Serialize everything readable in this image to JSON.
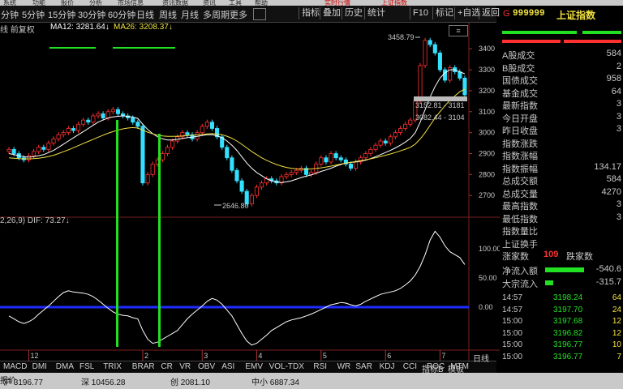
{
  "top_menu": [
    "系统",
    "功能",
    "报价",
    "分析",
    "市场信息",
    "资讯数据",
    "资讯",
    "工具",
    "帮助",
    "通达信",
    "实时行情",
    "上证指数"
  ],
  "toolbar": {
    "periods": [
      "分钟",
      "5分钟",
      "15分钟",
      "30分钟",
      "60分钟",
      "日线",
      "周线",
      "月线",
      "多周期",
      "更多"
    ],
    "search": "",
    "buttons": [
      "指标",
      "叠加",
      "历史",
      "统计",
      "F10",
      "标记",
      "+自选",
      "返回"
    ]
  },
  "legend": {
    "mode": "线 前复权",
    "ma12": "MA12: 3281.64↓",
    "ma26": "MA26: 3208.37↓",
    "high_label": "3458.79",
    "low_label": "2646.80",
    "range1": "3152.81 - 3181",
    "range2": "3082.44 - 3104",
    "macd": "2,26,9)  DIF: 73.27↓"
  },
  "chart_data": {
    "type": "candlestick",
    "price_ticks": [
      "3400",
      "3300",
      "3200",
      "3100",
      "3000",
      "2900",
      "2800",
      "2700"
    ],
    "macd_ticks": [
      "100.00",
      "50.00",
      "0.00"
    ],
    "x_ticks": [
      "12",
      "2",
      "3",
      "4",
      "5",
      "6",
      "7"
    ],
    "close": [
      2920,
      2900,
      2880,
      2870,
      2890,
      2910,
      2930,
      2920,
      2950,
      2970,
      2990,
      3000,
      3020,
      3010,
      3040,
      3060,
      3050,
      3080,
      3090,
      3070,
      3100,
      3110,
      3090,
      3080,
      3070,
      3050,
      3030,
      2760,
      2800,
      2850,
      2870,
      2900,
      2930,
      2960,
      2980,
      3000,
      2990,
      2970,
      3000,
      3030,
      3050,
      3020,
      2980,
      2930,
      2880,
      2820,
      2770,
      2720,
      2660,
      2700,
      2740,
      2760,
      2780,
      2770,
      2760,
      2790,
      2800,
      2810,
      2820,
      2830,
      2800,
      2810,
      2850,
      2880,
      2860,
      2900,
      2880,
      2870,
      2850,
      2830,
      2860,
      2880,
      2900,
      2920,
      2940,
      2960,
      2950,
      2980,
      3000,
      3020,
      3040,
      3060,
      3150,
      3320,
      3440,
      3420,
      3380,
      3300,
      3250,
      3310,
      3290,
      3260,
      3180
    ],
    "ma12": [
      2900,
      2895,
      2890,
      2885,
      2883,
      2885,
      2890,
      2895,
      2905,
      2915,
      2930,
      2945,
      2960,
      2975,
      2990,
      3005,
      3020,
      3035,
      3050,
      3060,
      3070,
      3075,
      3078,
      3080,
      3078,
      3074,
      3068,
      3040,
      3015,
      2995,
      2980,
      2970,
      2965,
      2965,
      2968,
      2972,
      2976,
      2978,
      2982,
      2986,
      2990,
      2990,
      2985,
      2975,
      2960,
      2940,
      2915,
      2885,
      2855,
      2830,
      2810,
      2795,
      2780,
      2770,
      2765,
      2762,
      2765,
      2770,
      2778,
      2786,
      2792,
      2798,
      2806,
      2815,
      2822,
      2830,
      2840,
      2848,
      2855,
      2858,
      2860,
      2864,
      2868,
      2876,
      2885,
      2895,
      2905,
      2915,
      2927,
      2940,
      2955,
      2972,
      3000,
      3050,
      3110,
      3170,
      3220,
      3260,
      3285,
      3300,
      3300,
      3290,
      3281
    ],
    "ma26": [
      2880,
      2878,
      2876,
      2875,
      2875,
      2876,
      2878,
      2881,
      2886,
      2892,
      2900,
      2909,
      2918,
      2928,
      2938,
      2948,
      2958,
      2968,
      2978,
      2988,
      2997,
      3005,
      3012,
      3018,
      3022,
      3024,
      3022,
      3012,
      3002,
      2994,
      2988,
      2984,
      2982,
      2982,
      2983,
      2984,
      2986,
      2988,
      2990,
      2992,
      2994,
      2995,
      2994,
      2990,
      2983,
      2973,
      2960,
      2944,
      2927,
      2910,
      2895,
      2880,
      2868,
      2857,
      2848,
      2840,
      2834,
      2830,
      2827,
      2826,
      2826,
      2827,
      2829,
      2832,
      2836,
      2840,
      2845,
      2850,
      2854,
      2858,
      2862,
      2866,
      2870,
      2875,
      2880,
      2886,
      2892,
      2898,
      2905,
      2913,
      2921,
      2930,
      2945,
      2970,
      3000,
      3035,
      3070,
      3100,
      3128,
      3155,
      3175,
      3195,
      3208
    ],
    "dif": [
      -15,
      -20,
      -25,
      -28,
      -25,
      -20,
      -12,
      -5,
      2,
      10,
      18,
      25,
      28,
      26,
      25,
      24,
      22,
      18,
      12,
      5,
      -2,
      -8,
      -12,
      -14,
      -15,
      -18,
      -20,
      -40,
      -55,
      -62,
      -60,
      -55,
      -50,
      -45,
      -40,
      -30,
      -20,
      -12,
      -5,
      2,
      10,
      15,
      12,
      5,
      -5,
      -15,
      -30,
      -45,
      -58,
      -65,
      -62,
      -55,
      -48,
      -40,
      -35,
      -30,
      -25,
      -22,
      -20,
      -18,
      -15,
      -12,
      -8,
      -4,
      0,
      4,
      6,
      8,
      7,
      4,
      2,
      5,
      10,
      14,
      18,
      22,
      24,
      26,
      28,
      32,
      38,
      45,
      55,
      70,
      90,
      115,
      130,
      120,
      105,
      95,
      90,
      85,
      73
    ]
  },
  "right_panel": {
    "code": "999999",
    "name": "上证指数",
    "rows": [
      {
        "k": "A股成交",
        "v": "584"
      },
      {
        "k": "B股成交",
        "v": "2"
      },
      {
        "k": "国债成交",
        "v": "958"
      },
      {
        "k": "基金成交",
        "v": "64"
      },
      {
        "k": "最新指数",
        "v": "3"
      },
      {
        "k": "今日开盘",
        "v": "3"
      },
      {
        "k": "昨日收盘",
        "v": "3"
      },
      {
        "k": "指数涨跌",
        "v": ""
      },
      {
        "k": "指数涨幅",
        "v": ""
      },
      {
        "k": "指数振幅",
        "v": "134.17"
      },
      {
        "k": "总成交额",
        "v": "584"
      },
      {
        "k": "总成交量",
        "v": "4270"
      },
      {
        "k": "最高指数",
        "v": "3"
      },
      {
        "k": "最低指数",
        "v": "3"
      },
      {
        "k": "指数量比",
        "v": ""
      },
      {
        "k": "上证换手",
        "v": ""
      }
    ],
    "up_label": "涨家数",
    "up_count": "109",
    "down_label": "跌家数",
    "net_inflow_label": "净流入额",
    "net_inflow": "-540.6",
    "big_inflow_label": "大宗流入",
    "big_inflow": "-315.7",
    "ticks": [
      {
        "t": "14:57",
        "p": "3198.24",
        "v": "64"
      },
      {
        "t": "14:57",
        "p": "3197.70",
        "v": "24"
      },
      {
        "t": "15:00",
        "p": "3197.68",
        "v": "12"
      },
      {
        "t": "15:00",
        "p": "3196.82",
        "v": "12"
      },
      {
        "t": "15:00",
        "p": "3196.77",
        "v": "10"
      },
      {
        "t": "15:00",
        "p": "3196.77",
        "v": "7"
      }
    ],
    "bottom_tabs": [
      "笔",
      "价",
      "细",
      "势",
      "指",
      "联",
      "值",
      "主"
    ]
  },
  "bottom_tabs": [
    "MACD",
    "DMI",
    "DMA",
    "FSL",
    "TRIX",
    "BRAR",
    "CR",
    "VR",
    "OBV",
    "ASI",
    "EMV",
    "VOL-TDX",
    "RSI",
    "WR",
    "SAR",
    "KDJ",
    "CCI",
    "ROC",
    "MTM"
  ],
  "bottom_right": [
    "指标B",
    "模板"
  ],
  "tab_left": "报价",
  "day_label": "日线",
  "status": [
    "沪 3196.77",
    "深 10456.28",
    "创 2081.10",
    "中小 6887.34"
  ],
  "colors": {
    "up": "#ff3030",
    "down": "#33e0ff",
    "ma12": "#ffffff",
    "ma26": "#f0e040",
    "zero_line": "#1f2cff",
    "highlight": "#22e022"
  }
}
